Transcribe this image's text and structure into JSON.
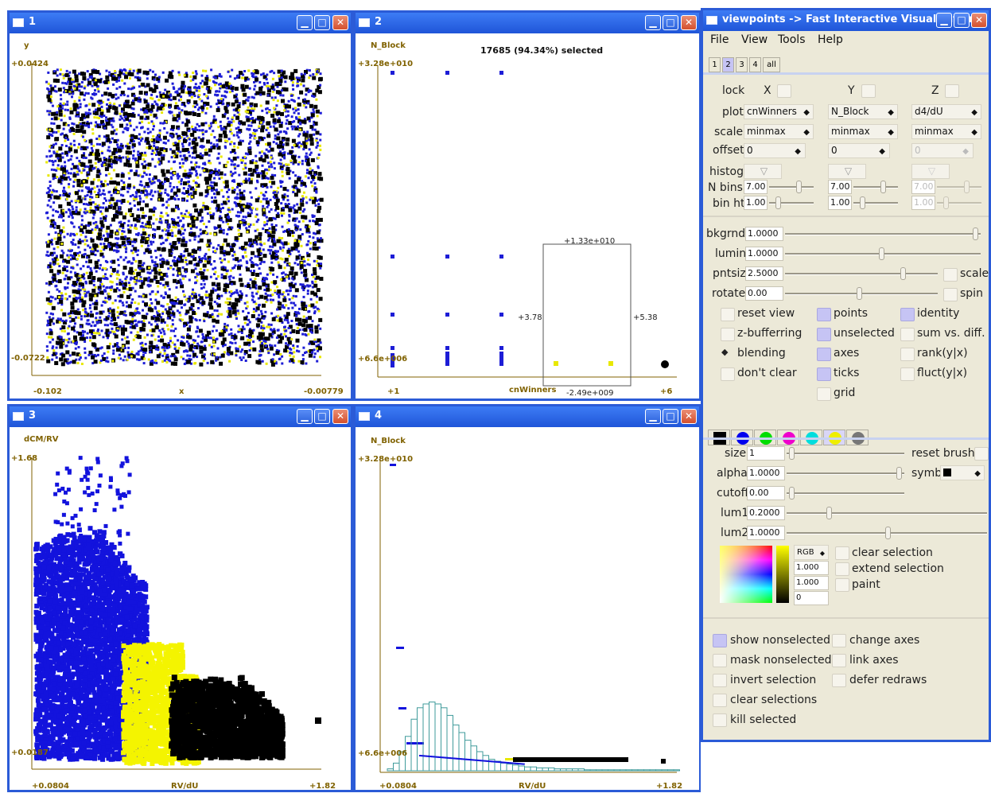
{
  "windows": {
    "w1": {
      "title": "1",
      "ylabel": "y",
      "xlabel": "x",
      "ymax": "+0.0424",
      "ymin": "-0.0722",
      "xmin": "-0.102",
      "xmax": "-0.00779"
    },
    "w2": {
      "title": "2",
      "ylabel": "N_Block",
      "xlabel": "cnWinners",
      "ymax": "+3.28e+010",
      "ymin": "+6.6e+006",
      "xmin": "+1",
      "xmax": "+6",
      "selected": "17685 (94.34%) selected",
      "box_top": "+1.33e+010",
      "box_left": "+3.78",
      "box_right": "+5.38",
      "box_bottom": "-2.49e+009"
    },
    "w3": {
      "title": "3",
      "ylabel": "dCM/RV",
      "xlabel": "RV/dU",
      "ymax": "+1.68",
      "ymin": "+0.0187",
      "xmin": "+0.0804",
      "xmax": "+1.82"
    },
    "w4": {
      "title": "4",
      "ylabel": "N_Block",
      "xlabel": "RV/dU",
      "ymax": "+3.28e+010",
      "ymin": "+6.6e+006",
      "xmin": "+0.0804",
      "xmax": "+1.82"
    }
  },
  "control": {
    "title": "viewpoints -> Fast Interactive Visualization",
    "menu": [
      "File",
      "View",
      "Tools",
      "Help"
    ],
    "tabs": [
      "1",
      "2",
      "3",
      "4",
      "all"
    ],
    "active_tab": "2",
    "lock": "lock",
    "x": "X",
    "y": "Y",
    "z": "Z",
    "plot_label": "plot",
    "scale_label": "scale",
    "offset_label": "offset",
    "plot": [
      "cnWinners",
      "N_Block",
      "d4/dU"
    ],
    "scale": [
      "minmax",
      "minmax",
      "minmax"
    ],
    "offset": [
      "0",
      "0",
      "0"
    ],
    "histog": "histog",
    "nbins": "N bins",
    "binht": "bin ht",
    "nbins_vals": [
      "7.00",
      "7.00",
      "7.00"
    ],
    "binht_vals": [
      "1.00",
      "1.00",
      "1.00"
    ],
    "bkgrnd": "bkgrnd",
    "bkgrnd_val": "1.0000",
    "lumin": "lumin",
    "lumin_val": "1.0000",
    "pntsiz": "pntsiz",
    "pntsiz_val": "2.5000",
    "scale_cb": "scale",
    "rotate": "rotate",
    "rotate_val": "0.00",
    "spin_cb": "spin",
    "opts_col1": [
      "reset view",
      "z-bufferring",
      "blending",
      "don't clear"
    ],
    "opts_col2": [
      "points",
      "unselected",
      "axes",
      "ticks",
      "grid"
    ],
    "opts_col3": [
      "identity",
      "sum vs. diff.",
      "rank(y|x)",
      "fluct(y|x)"
    ],
    "brush_colors": [
      "#000000",
      "#0000ee",
      "#00dd00",
      "#ee00cc",
      "#00dddd",
      "#eeee00",
      "#777777"
    ],
    "size": "size",
    "size_val": "1",
    "reset_brush": "reset brush",
    "alpha": "alpha",
    "alpha_val": "1.0000",
    "symb": "symb",
    "cutoff": "cutoff",
    "cutoff_val": "0.00",
    "lum1": "lum1",
    "lum1_val": "0.2000",
    "lum2": "lum2",
    "lum2_val": "1.0000",
    "rgb": "RGB",
    "rgb_vals": [
      "1.000",
      "1.000",
      "0"
    ],
    "clear_selection": "clear selection",
    "extend_selection": "extend selection",
    "paint": "paint",
    "bottom_col1": [
      "show nonselected",
      "mask nonselected",
      "invert selection",
      "clear selections",
      "kill selected"
    ],
    "bottom_col2": [
      "change axes",
      "link axes",
      "defer redraws"
    ]
  }
}
